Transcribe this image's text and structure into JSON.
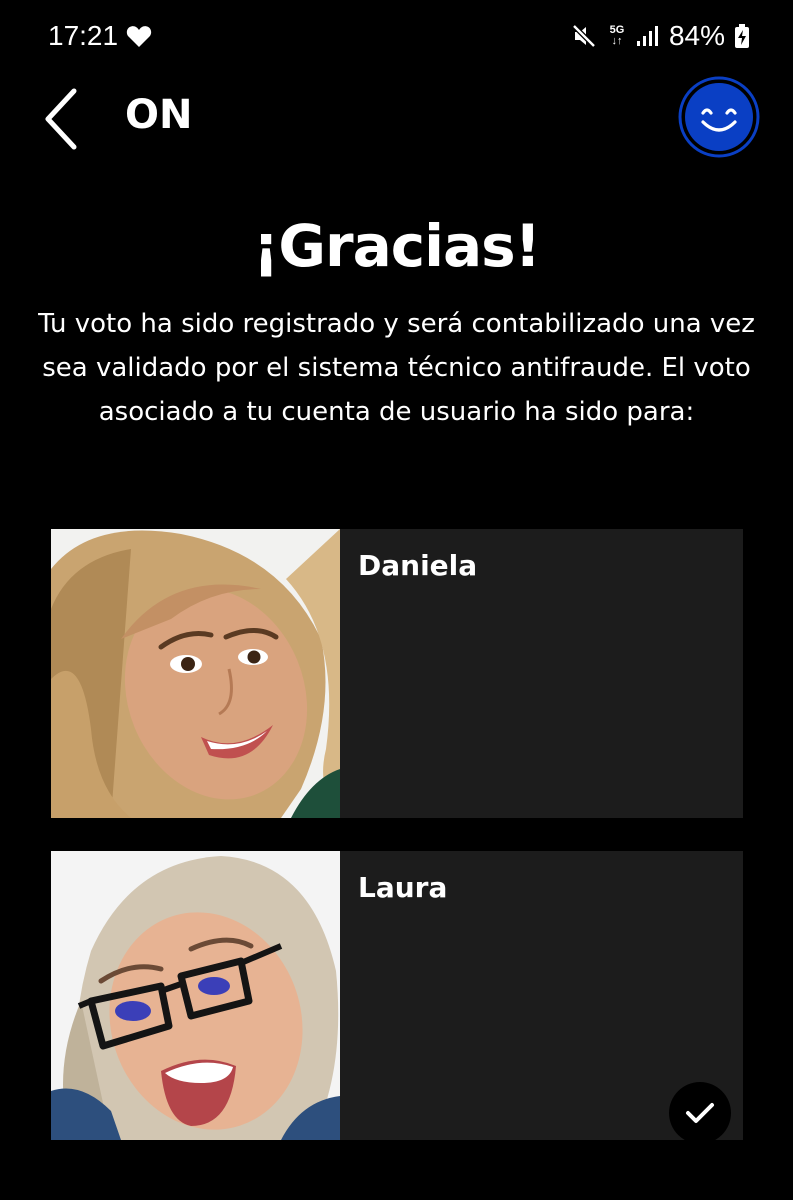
{
  "status_bar": {
    "time": "17:21",
    "network": "5G",
    "battery": "84%"
  },
  "header": {
    "title": "ON"
  },
  "headline": "¡Gracias!",
  "message": "Tu voto ha sido registrado y será contabilizado una vez sea validado por el sistema técnico antifraude. El voto asociado a tu cuenta de usuario ha sido para:",
  "candidates": [
    {
      "name": "Daniela",
      "selected": false
    },
    {
      "name": "Laura",
      "selected": true
    }
  ],
  "colors": {
    "background": "#000000",
    "card": "#1c1c1c",
    "accent": "#0a3fc4"
  },
  "icons": {
    "back": "chevron-left-icon",
    "profile": "smiley-face-icon",
    "selected": "checkmark-icon"
  }
}
